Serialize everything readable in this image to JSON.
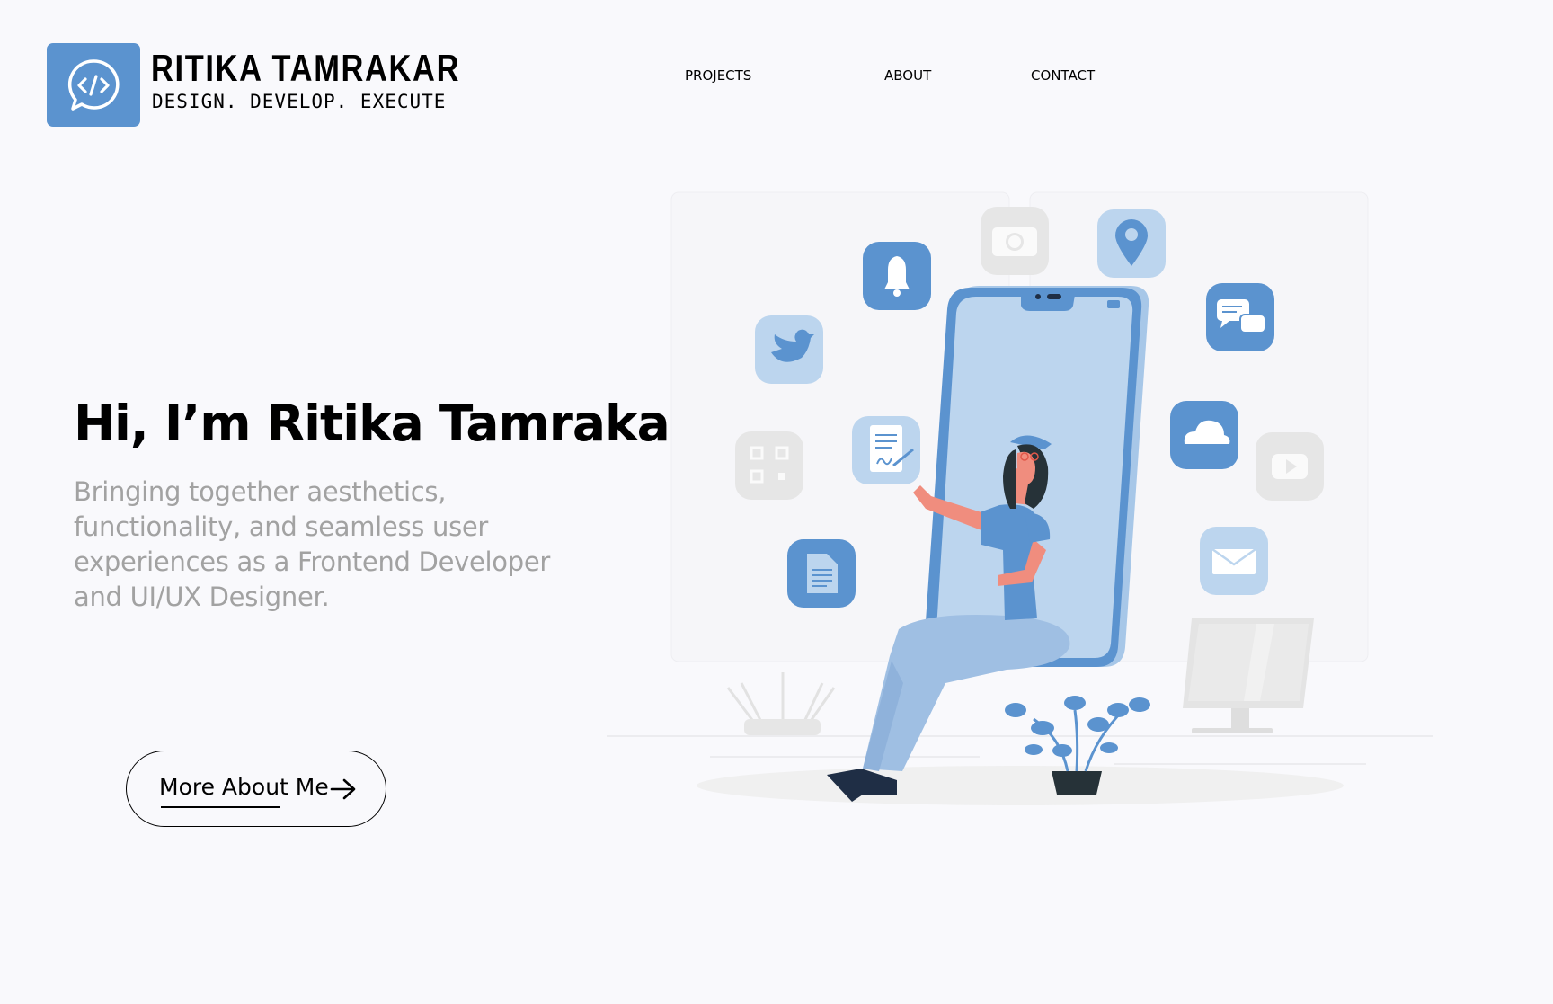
{
  "brand": {
    "name": "RITIKA TAMRAKAR",
    "tagline": "DESIGN. DEVELOP. EXECUTE",
    "logo_icon": "code-chat-bubble-icon",
    "logo_color": "#5b93cf"
  },
  "nav": {
    "items": [
      {
        "label": "PROJECTS"
      },
      {
        "label": "ABOUT"
      },
      {
        "label": "CONTACT"
      }
    ]
  },
  "hero": {
    "title": "Hi, I’m Ritika Tamrakar",
    "subtitle": "Bringing together aesthetics, functionality, and seamless user experiences as a Frontend Developer and UI/UX Designer.",
    "cta_label": "More About Me",
    "cta_icon": "arrow-right-icon"
  },
  "illustration": {
    "icons": [
      "bell-icon",
      "camera-icon",
      "location-pin-icon",
      "chat-icon",
      "twitter-icon",
      "qr-code-icon",
      "signed-document-icon",
      "cloud-icon",
      "video-play-icon",
      "file-icon",
      "mail-icon"
    ],
    "colors": {
      "accent": "#5b93cf",
      "light": "#bcd5ee",
      "gray": "#e6e6e6"
    }
  }
}
